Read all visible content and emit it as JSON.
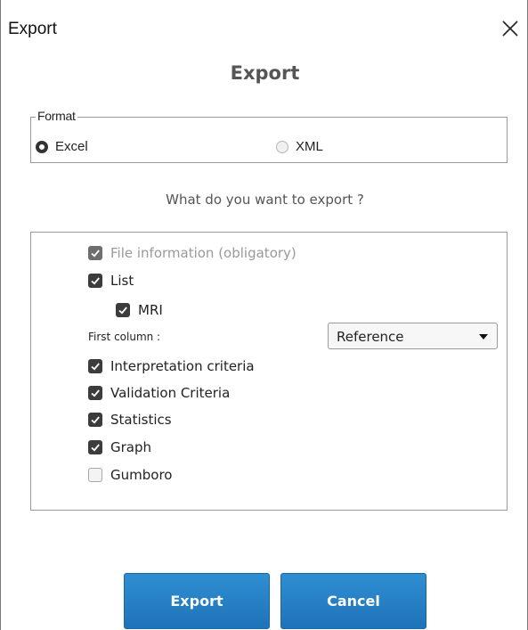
{
  "window": {
    "title": "Export"
  },
  "dialog": {
    "heading": "Export"
  },
  "format": {
    "legend": "Format",
    "options": [
      {
        "label": "Excel",
        "selected": true
      },
      {
        "label": "XML",
        "selected": false
      }
    ]
  },
  "question": "What do you want to export ?",
  "items": {
    "file_info": {
      "label": "File information (obligatory)",
      "checked": true,
      "disabled": true
    },
    "list": {
      "label": "List",
      "checked": true
    },
    "mri": {
      "label": "MRI",
      "checked": true
    },
    "first_column_label": "First column :",
    "first_column_value": "Reference",
    "interpretation": {
      "label": "Interpretation criteria",
      "checked": true
    },
    "validation": {
      "label": "Validation Criteria",
      "checked": true
    },
    "statistics": {
      "label": "Statistics",
      "checked": true
    },
    "graph": {
      "label": "Graph",
      "checked": true
    },
    "gumboro": {
      "label": "Gumboro",
      "checked": false
    }
  },
  "buttons": {
    "export": "Export",
    "cancel": "Cancel"
  },
  "icons": {
    "close": "close-icon",
    "check": "checkmark-icon",
    "dropdown": "chevron-down-icon"
  },
  "colors": {
    "accent": "#2680c4",
    "checkbox_checked": "#3c3c3c"
  }
}
